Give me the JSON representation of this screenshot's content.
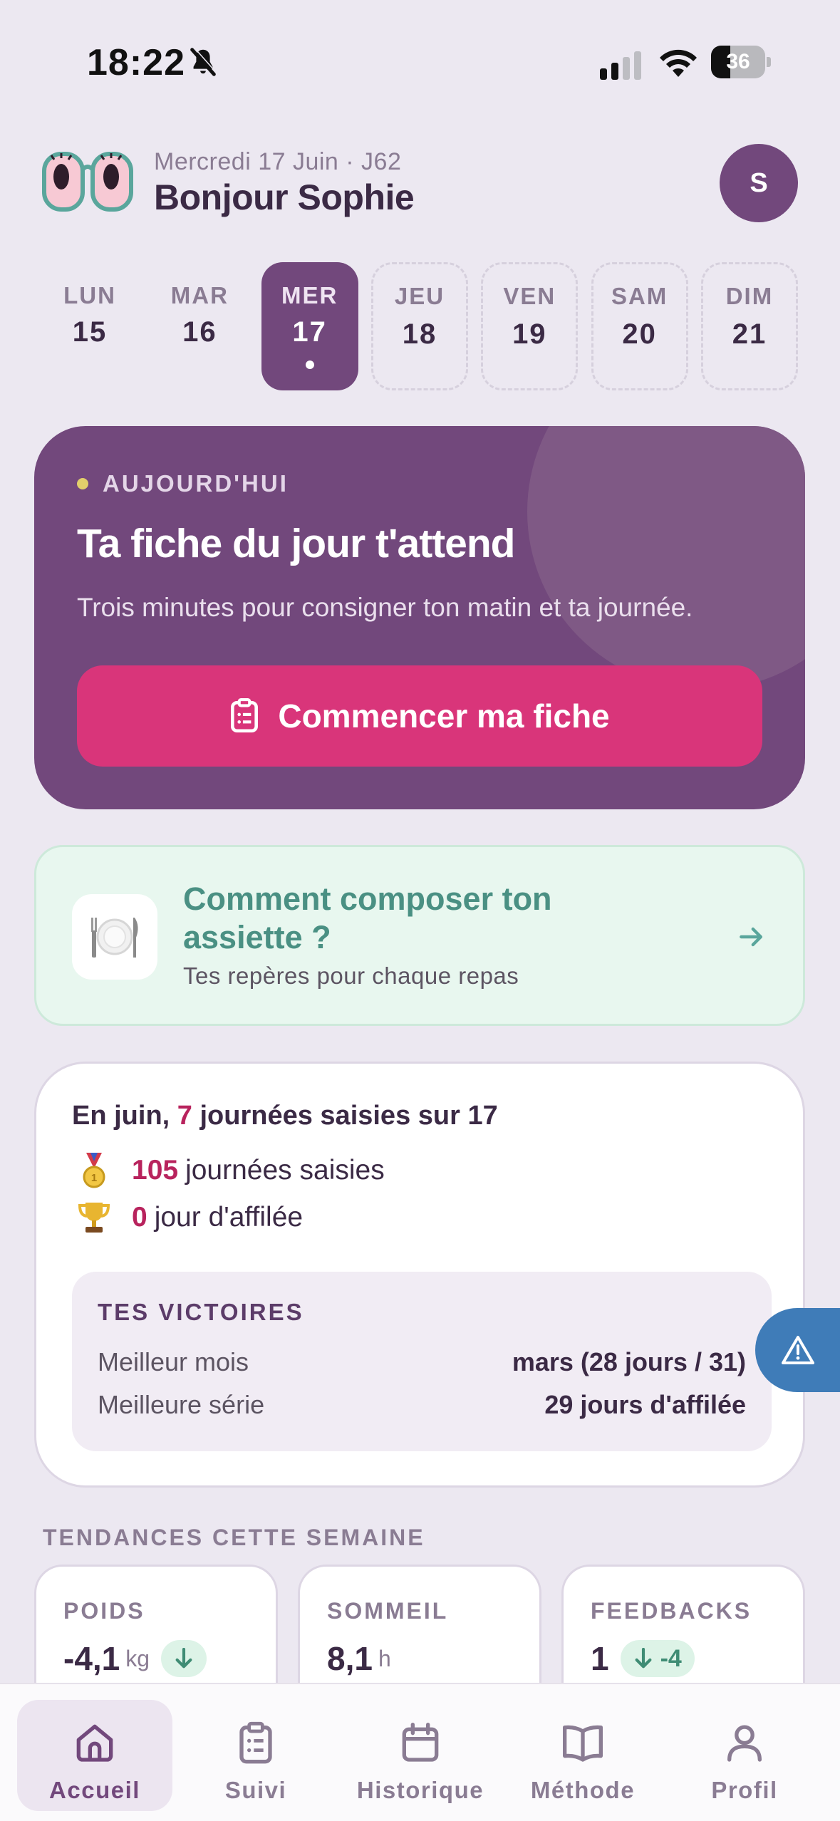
{
  "status_bar": {
    "time": "18:22",
    "battery": "36",
    "battery_level": 0.36
  },
  "header": {
    "date": "Mercredi 17 Juin · J62",
    "greeting": "Bonjour Sophie",
    "avatar_initial": "S"
  },
  "week": [
    {
      "label": "LUN",
      "num": "15",
      "state": "past"
    },
    {
      "label": "MAR",
      "num": "16",
      "state": "past"
    },
    {
      "label": "MER",
      "num": "17",
      "state": "active"
    },
    {
      "label": "JEU",
      "num": "18",
      "state": "future"
    },
    {
      "label": "VEN",
      "num": "19",
      "state": "future"
    },
    {
      "label": "SAM",
      "num": "20",
      "state": "future"
    },
    {
      "label": "DIM",
      "num": "21",
      "state": "future"
    }
  ],
  "today_card": {
    "kicker": "AUJOURD'HUI",
    "title": "Ta fiche du jour t'attend",
    "subtitle": "Trois minutes pour consigner ton matin et ta journée.",
    "button_label": "Commencer ma fiche"
  },
  "plate_card": {
    "title": "Comment composer ton assiette ?",
    "subtitle": "Tes repères pour chaque repas"
  },
  "stats": {
    "headline_prefix": "En juin, ",
    "headline_count": "7",
    "headline_suffix": " journées saisies sur 17",
    "total_count": "105",
    "total_label": "journées saisies",
    "streak_count": "0",
    "streak_label": "jour d'affilée",
    "victories": {
      "title": "TES VICTOIRES",
      "best_month_label": "Meilleur mois",
      "best_month_value": "mars (28 jours / 31)",
      "best_streak_label": "Meilleure série",
      "best_streak_value": "29 jours d'affilée"
    }
  },
  "trends": {
    "title": "TENDANCES CETTE SEMAINE",
    "cards": [
      {
        "label": "POIDS",
        "value": "-4,1",
        "unit": "kg",
        "badge": ""
      },
      {
        "label": "SOMMEIL",
        "value": "8,1",
        "unit": "h",
        "badge": null
      },
      {
        "label": "FEEDBACKS",
        "value": "1",
        "unit": "",
        "badge": "-4"
      }
    ]
  },
  "nav": {
    "items": [
      {
        "label": "Accueil",
        "icon": "home-icon"
      },
      {
        "label": "Suivi",
        "icon": "clipboard-icon"
      },
      {
        "label": "Historique",
        "icon": "calendar-icon"
      },
      {
        "label": "Méthode",
        "icon": "book-icon"
      },
      {
        "label": "Profil",
        "icon": "user-icon"
      }
    ],
    "active": "Accueil"
  },
  "colors": {
    "primary": "#72487c",
    "cta": "#d9357a",
    "accent": "#b8235d",
    "mint": "#4a9083",
    "alert": "#3f7cb8"
  }
}
